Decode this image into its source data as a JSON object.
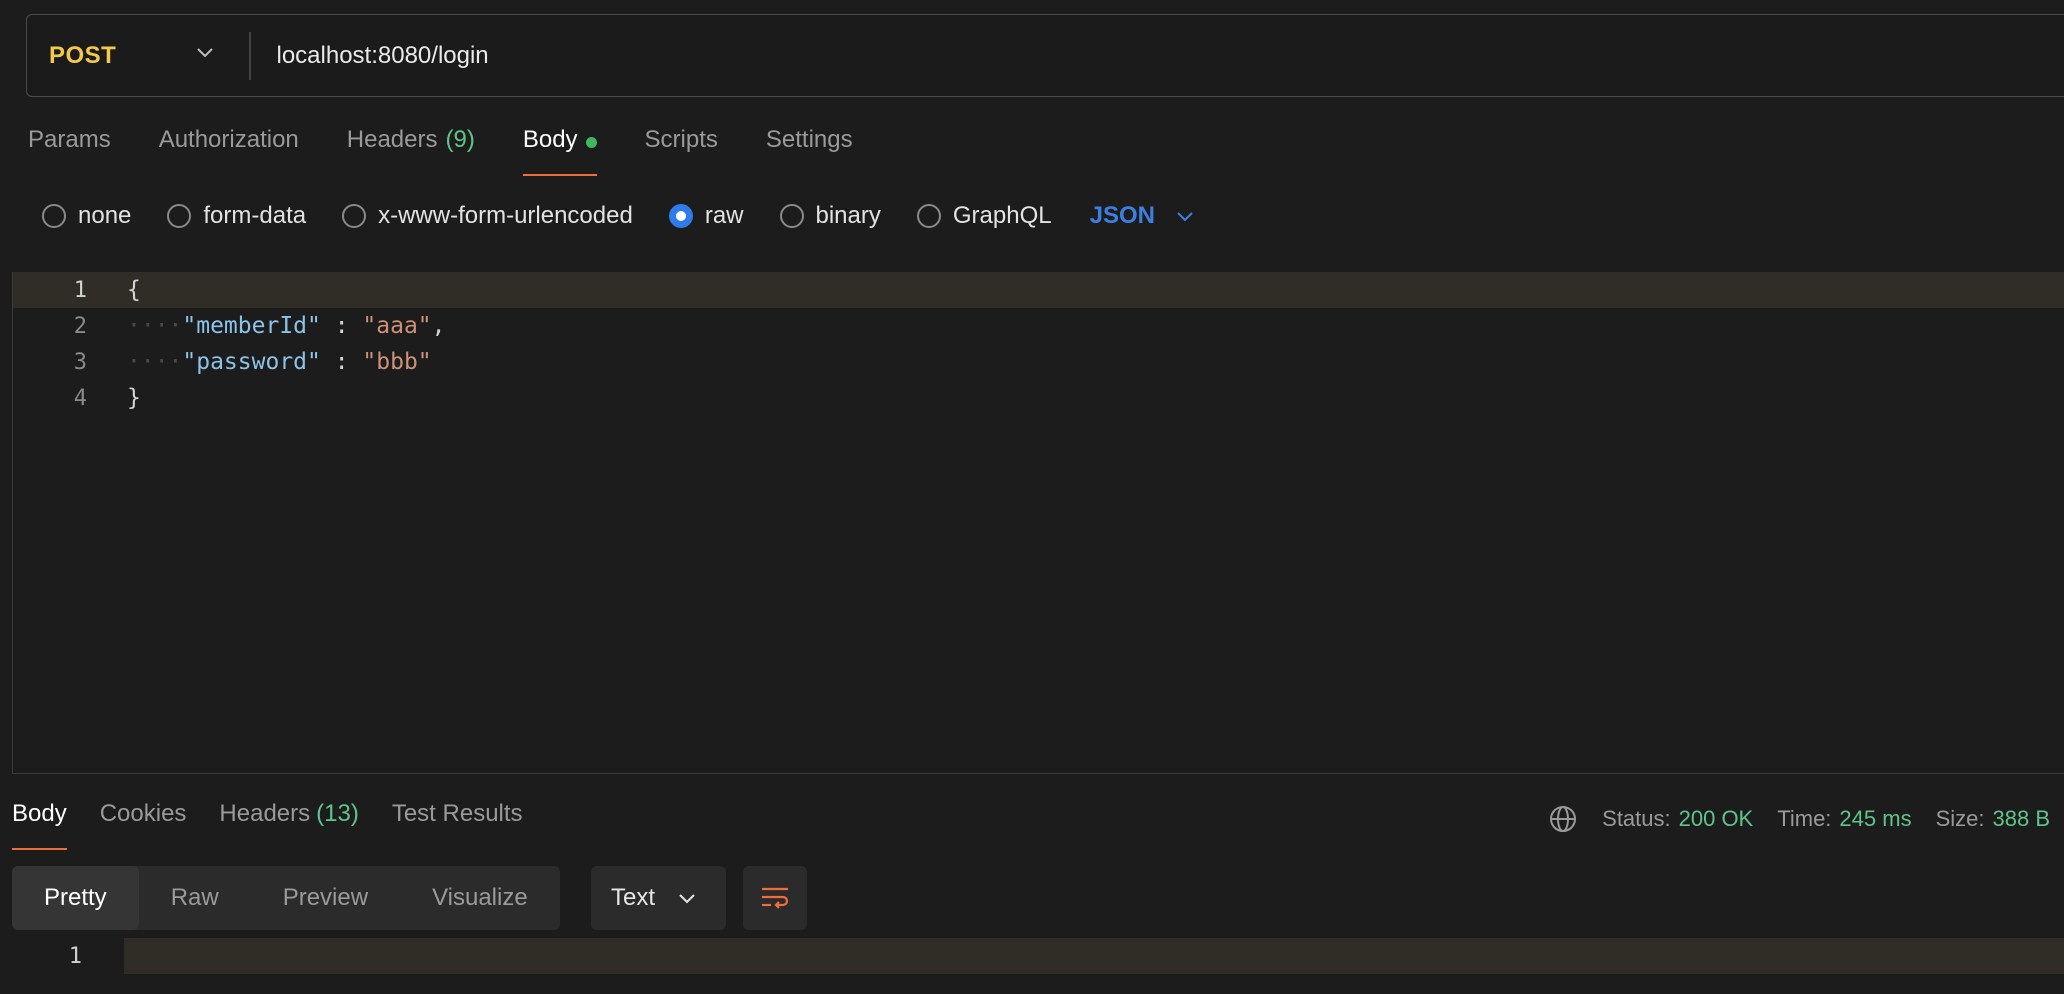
{
  "request": {
    "method": "POST",
    "url": "localhost:8080/login"
  },
  "request_tabs": [
    {
      "label": "Params"
    },
    {
      "label": "Authorization"
    },
    {
      "label": "Headers",
      "count": "(9)"
    },
    {
      "label": "Body",
      "active": true
    },
    {
      "label": "Scripts"
    },
    {
      "label": "Settings"
    }
  ],
  "body_types": [
    {
      "label": "none"
    },
    {
      "label": "form-data"
    },
    {
      "label": "x-www-form-urlencoded"
    },
    {
      "label": "raw",
      "selected": true
    },
    {
      "label": "binary"
    },
    {
      "label": "GraphQL"
    }
  ],
  "body_language": "JSON",
  "editor": {
    "lines": [
      {
        "n": "1",
        "text": "{"
      },
      {
        "n": "2",
        "key": "\"memberId\"",
        "sep": " : ",
        "value": "\"aaa\"",
        "trail": ","
      },
      {
        "n": "3",
        "key": "\"password\"",
        "sep": " : ",
        "value": "\"bbb\"",
        "trail": ""
      },
      {
        "n": "4",
        "text": "}"
      }
    ]
  },
  "response_tabs": [
    {
      "label": "Body",
      "active": true
    },
    {
      "label": "Cookies"
    },
    {
      "label": "Headers",
      "count": "(13)"
    },
    {
      "label": "Test Results"
    }
  ],
  "response_status": {
    "status_label": "Status:",
    "status_value": "200 OK",
    "time_label": "Time:",
    "time_value": "245 ms",
    "size_label": "Size:",
    "size_value": "388 B"
  },
  "response_views": [
    "Pretty",
    "Raw",
    "Preview",
    "Visualize"
  ],
  "response_format": "Text",
  "response_lines": [
    {
      "n": "1"
    }
  ],
  "colors": {
    "accent_tab": "#ef6c3d",
    "method_post": "#f2c94c",
    "success_green": "#5fc48a",
    "radio_blue": "#2f7bea"
  }
}
